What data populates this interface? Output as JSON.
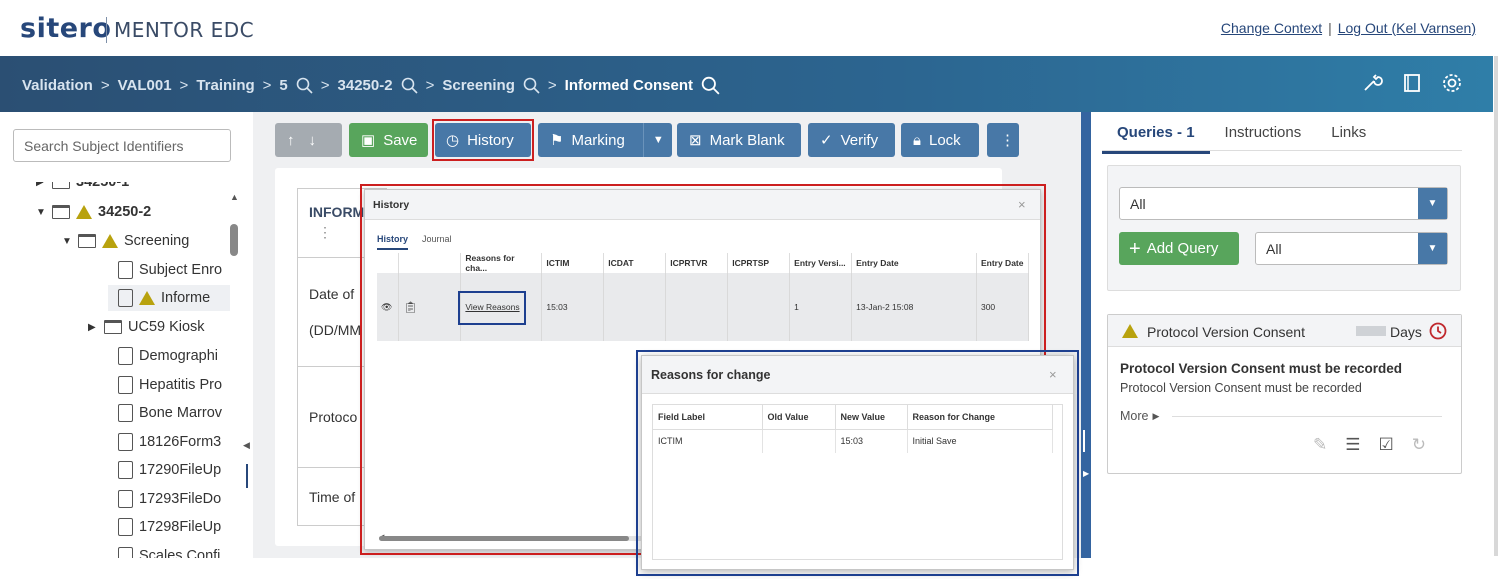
{
  "header": {
    "logo_main": "sitero",
    "logo_product": "MENTOR EDC",
    "change_context": "Change Context",
    "separator": "|",
    "logout": "Log Out (Kel Varnsen)"
  },
  "breadcrumb": {
    "items": [
      "Validation",
      "VAL001",
      "Training",
      "5",
      "34250-2",
      "Screening"
    ],
    "current": "Informed Consent",
    "separator": ">"
  },
  "left": {
    "search_placeholder": "Search Subject Identifiers",
    "tree": [
      {
        "label": "34250-1"
      },
      {
        "label": "34250-2"
      },
      {
        "label": "Screening"
      },
      {
        "label": "Subject Enro"
      },
      {
        "label": "Informe"
      },
      {
        "label": "UC59 Kiosk"
      },
      {
        "label": "Demographi"
      },
      {
        "label": "Hepatitis Pro"
      },
      {
        "label": "Bone Marrov"
      },
      {
        "label": "18126Form3"
      },
      {
        "label": "17290FileUp"
      },
      {
        "label": "17293FileDo"
      },
      {
        "label": "17298FileUp"
      },
      {
        "label": "Scales Confi"
      }
    ]
  },
  "toolbar": {
    "save": "Save",
    "history": "History",
    "marking": "Marking",
    "mark_blank": "Mark Blank",
    "verify": "Verify",
    "lock": "Lock"
  },
  "form": {
    "section": "INFORM",
    "date_label": "Date of",
    "date_format": "(DD/MM",
    "protocol_label": "Protoco",
    "time_label": "Time of"
  },
  "history_dialog": {
    "title": "History",
    "close": "×",
    "tabs": [
      "History",
      "Journal"
    ],
    "columns": [
      "",
      "",
      "Reasons for cha...",
      "ICTIM",
      "ICDAT",
      "ICPRTVR",
      "ICPRTSP",
      "Entry Versi...",
      "Entry Date",
      "Entry Date"
    ],
    "row": {
      "reasons": "View Reasons",
      "ictim": "15:03",
      "entry_version": "1",
      "entry_date": "13-Jan-2     15:08",
      "entry_date2": "300"
    }
  },
  "reasons_dialog": {
    "title": "Reasons for change",
    "close": "×",
    "columns": [
      "Field Label",
      "Old Value",
      "New Value",
      "Reason for Change"
    ],
    "rows": [
      {
        "field": "ICTIM",
        "old": "",
        "new": "15:03",
        "reason": "Initial Save"
      }
    ]
  },
  "right": {
    "tabs": [
      "Queries - 1",
      "Instructions",
      "Links"
    ],
    "filter1": "All",
    "add_query": "Add Query",
    "filter2": "All",
    "card": {
      "title": "Protocol Version Consent",
      "days": "Days",
      "heading": "Protocol Version Consent must be recorded",
      "body": "Protocol Version Consent must be recorded",
      "more": "More"
    }
  },
  "colors": {
    "nav": "#2c6590",
    "accent_blue": "#4878a7",
    "green": "#58a55c",
    "highlight_red": "#cc1f1f",
    "highlight_navy": "#1d3f8f"
  }
}
